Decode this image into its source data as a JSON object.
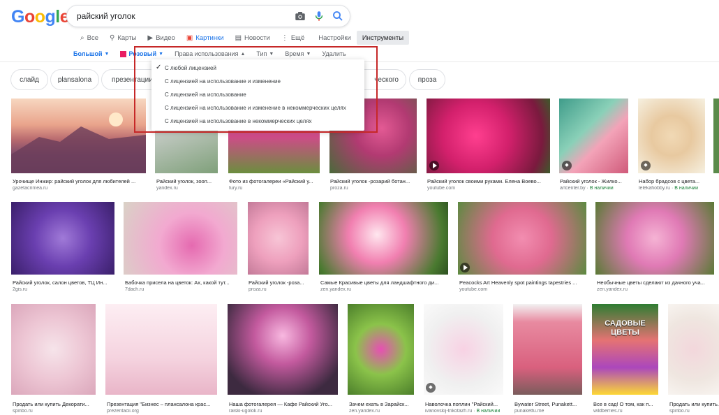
{
  "logo": [
    "G",
    "o",
    "o",
    "g",
    "l",
    "e"
  ],
  "search": {
    "query": "райский уголок"
  },
  "tabs": [
    {
      "icon": "search-icon",
      "glyph": "⌕",
      "label": "Все"
    },
    {
      "icon": "map-pin-icon",
      "glyph": "⚲",
      "label": "Карты"
    },
    {
      "icon": "video-icon",
      "glyph": "▶",
      "label": "Видео"
    },
    {
      "icon": "image-icon",
      "glyph": "▣",
      "label": "Картинки"
    },
    {
      "icon": "news-icon",
      "glyph": "▤",
      "label": "Новости"
    },
    {
      "icon": "more-icon",
      "glyph": "⋮",
      "label": "Ещё"
    },
    {
      "icon": "",
      "glyph": "",
      "label": "Настройки"
    },
    {
      "icon": "",
      "glyph": "",
      "label": "Инструменты"
    }
  ],
  "tools": {
    "size": "Большой",
    "color": "Розовый",
    "rights": "Права использования",
    "type": "Тип",
    "time": "Время",
    "clear": "Удалить"
  },
  "chips": [
    "слайд",
    "plansalona",
    "презентации",
    "ческого",
    "проза"
  ],
  "menu": {
    "items": [
      "С любой лицензией",
      "С лицензией на использование и изменение",
      "С лицензией на использование",
      "С лицензией на использование и изменение в некоммерческих целях",
      "С лицензией на использование в некоммерческих целях"
    ]
  },
  "row1": [
    {
      "caption": "Урочище Инжир: райский уголок для любителей ...",
      "source": "gazetacrimea.ru"
    },
    {
      "caption": "Райский уголок, зооп...",
      "source": "yandex.ru"
    },
    {
      "caption": "Фото из фотогалереи «Райский у...",
      "source": "tury.ru"
    },
    {
      "caption": "Райский уголок -розарий ботан...",
      "source": "proza.ru"
    },
    {
      "caption": "Райский уголок своими руками. Елена Воево...",
      "source": "youtube.com"
    },
    {
      "caption": "Райский уголок - Жилко...",
      "source": "artcenter.by",
      "avail": "В наличии"
    },
    {
      "caption": "Набор брадсов с цвета...",
      "source": "lelekahobby.ru",
      "avail": "В наличии"
    }
  ],
  "row2": [
    {
      "caption": "Райский уголок, салон цветов, ТЦ Ин...",
      "source": "2gis.ru"
    },
    {
      "caption": "Бабочка присела на цветок: Ах, какой тут...",
      "source": "7dach.ru"
    },
    {
      "caption": "Райский уголок -роза...",
      "source": "proza.ru"
    },
    {
      "caption": "Самые Красивые цветы для ландшафтного ди...",
      "source": "zen.yandex.ru"
    },
    {
      "caption": "Peacocks Art Heavenly spot paintings tapestries ...",
      "source": "youtube.com"
    },
    {
      "caption": "Необычные цветы сделают из дачного уча...",
      "source": "zen.yandex.ru"
    }
  ],
  "row3": [
    {
      "caption": "Продать или купить Декорати...",
      "source": "spinbo.ru"
    },
    {
      "caption": "Презентация \"Бизнес – плансалона крас...",
      "source": "prezentacii.org"
    },
    {
      "caption": "Наша фотогалерея — Кафе Райский Уго...",
      "source": "raiski-ugolok.ru"
    },
    {
      "caption": "Зачем ехать в Зарайск...",
      "source": "zen.yandex.ru"
    },
    {
      "caption": "Наволочка поплин \"Райский...",
      "source": "ivanovskij-trikotazh.ru",
      "avail": "В наличии"
    },
    {
      "caption": "Bywater Street, Punakett...",
      "source": "punakettu.me"
    },
    {
      "caption": "Все в сад! О том, как п...",
      "source": "wildberries.ru"
    },
    {
      "caption": "Продать или купить...",
      "source": "spinbo.ru"
    }
  ],
  "book_title": "САДОВЫЕ ЦВЕТЫ",
  "colors": {
    "accent": "#1a73e8",
    "highlight": "#c62828",
    "swatch": "#e91e63"
  }
}
